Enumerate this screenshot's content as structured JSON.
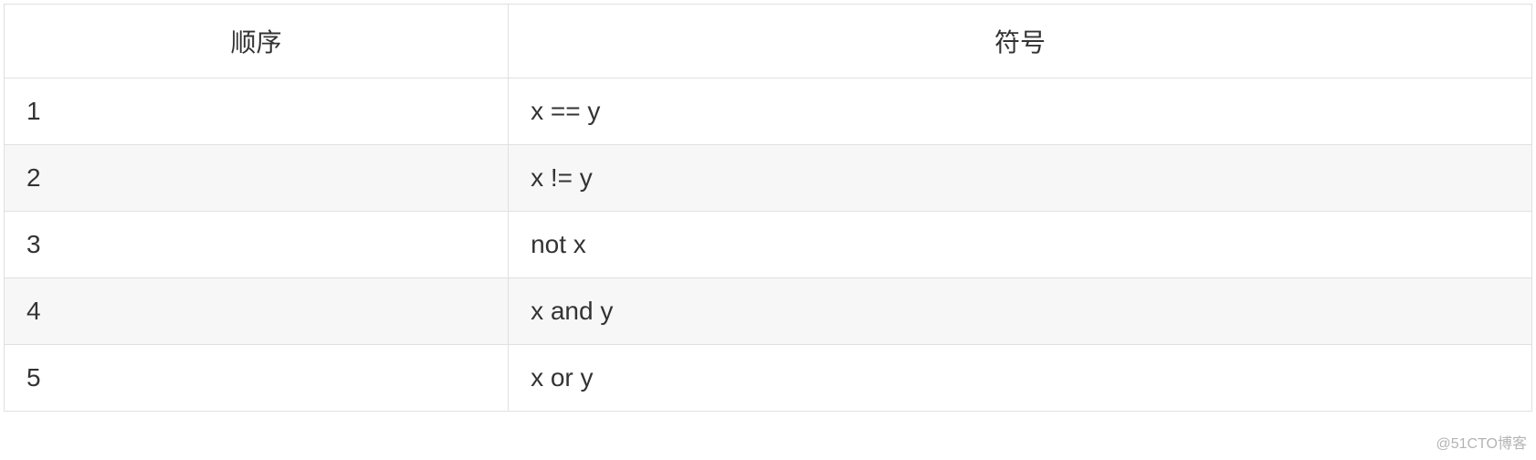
{
  "table": {
    "headers": {
      "order": "顺序",
      "symbol": "符号"
    },
    "rows": [
      {
        "order": "1",
        "symbol": "x == y"
      },
      {
        "order": "2",
        "symbol": "x != y"
      },
      {
        "order": "3",
        "symbol": "not x"
      },
      {
        "order": "4",
        "symbol": "x and y"
      },
      {
        "order": "5",
        "symbol": "x or y"
      }
    ]
  },
  "watermark": "@51CTO博客"
}
